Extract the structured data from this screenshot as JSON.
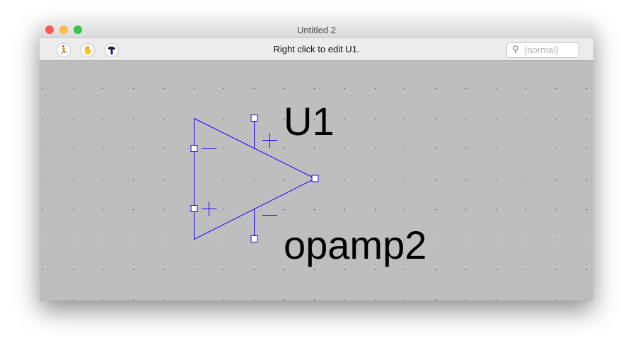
{
  "window": {
    "title": "Untitled 2"
  },
  "toolbar": {
    "tools": [
      "run-icon",
      "hand-icon",
      "hammer-icon"
    ],
    "status": "Right click to edit U1.",
    "search_placeholder": "(normal)"
  },
  "schematic": {
    "ref": "U1",
    "value": "opamp2",
    "wire_color": "#2200ff",
    "pin_labels": {
      "in_minus": "—",
      "in_plus": "+",
      "supply_plus": "+",
      "supply_minus": "—"
    }
  }
}
